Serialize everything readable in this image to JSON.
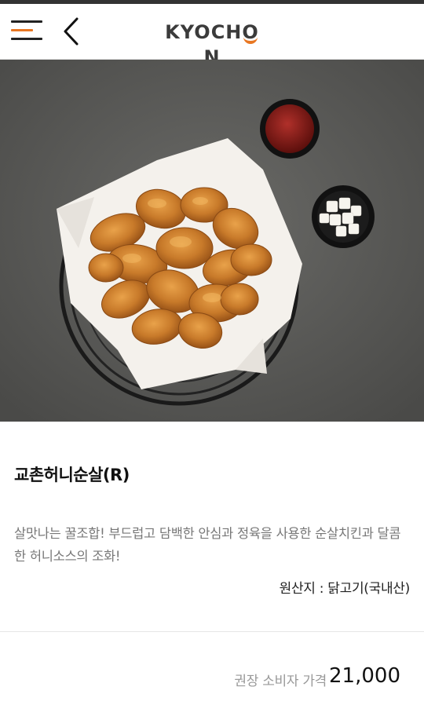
{
  "header": {
    "logo_prefix": "KYOCH",
    "logo_o": "O",
    "logo_suffix": "N",
    "menu_icon": "hamburger-menu-icon",
    "back_icon": "chevron-left-icon"
  },
  "product": {
    "name": "교촌허니순살(R)",
    "description": "살맛나는 꿀조합! 부드럽고 담백한 안심과 정육을 사용한 순살치킨과 달콤한 허니소스의 조화!",
    "origin": "원산지 : 닭고기(국내산)"
  },
  "price": {
    "label": "권장 소비자 가격",
    "value": "21,000"
  },
  "colors": {
    "brand_orange": "#e87722",
    "dark": "#222222"
  }
}
